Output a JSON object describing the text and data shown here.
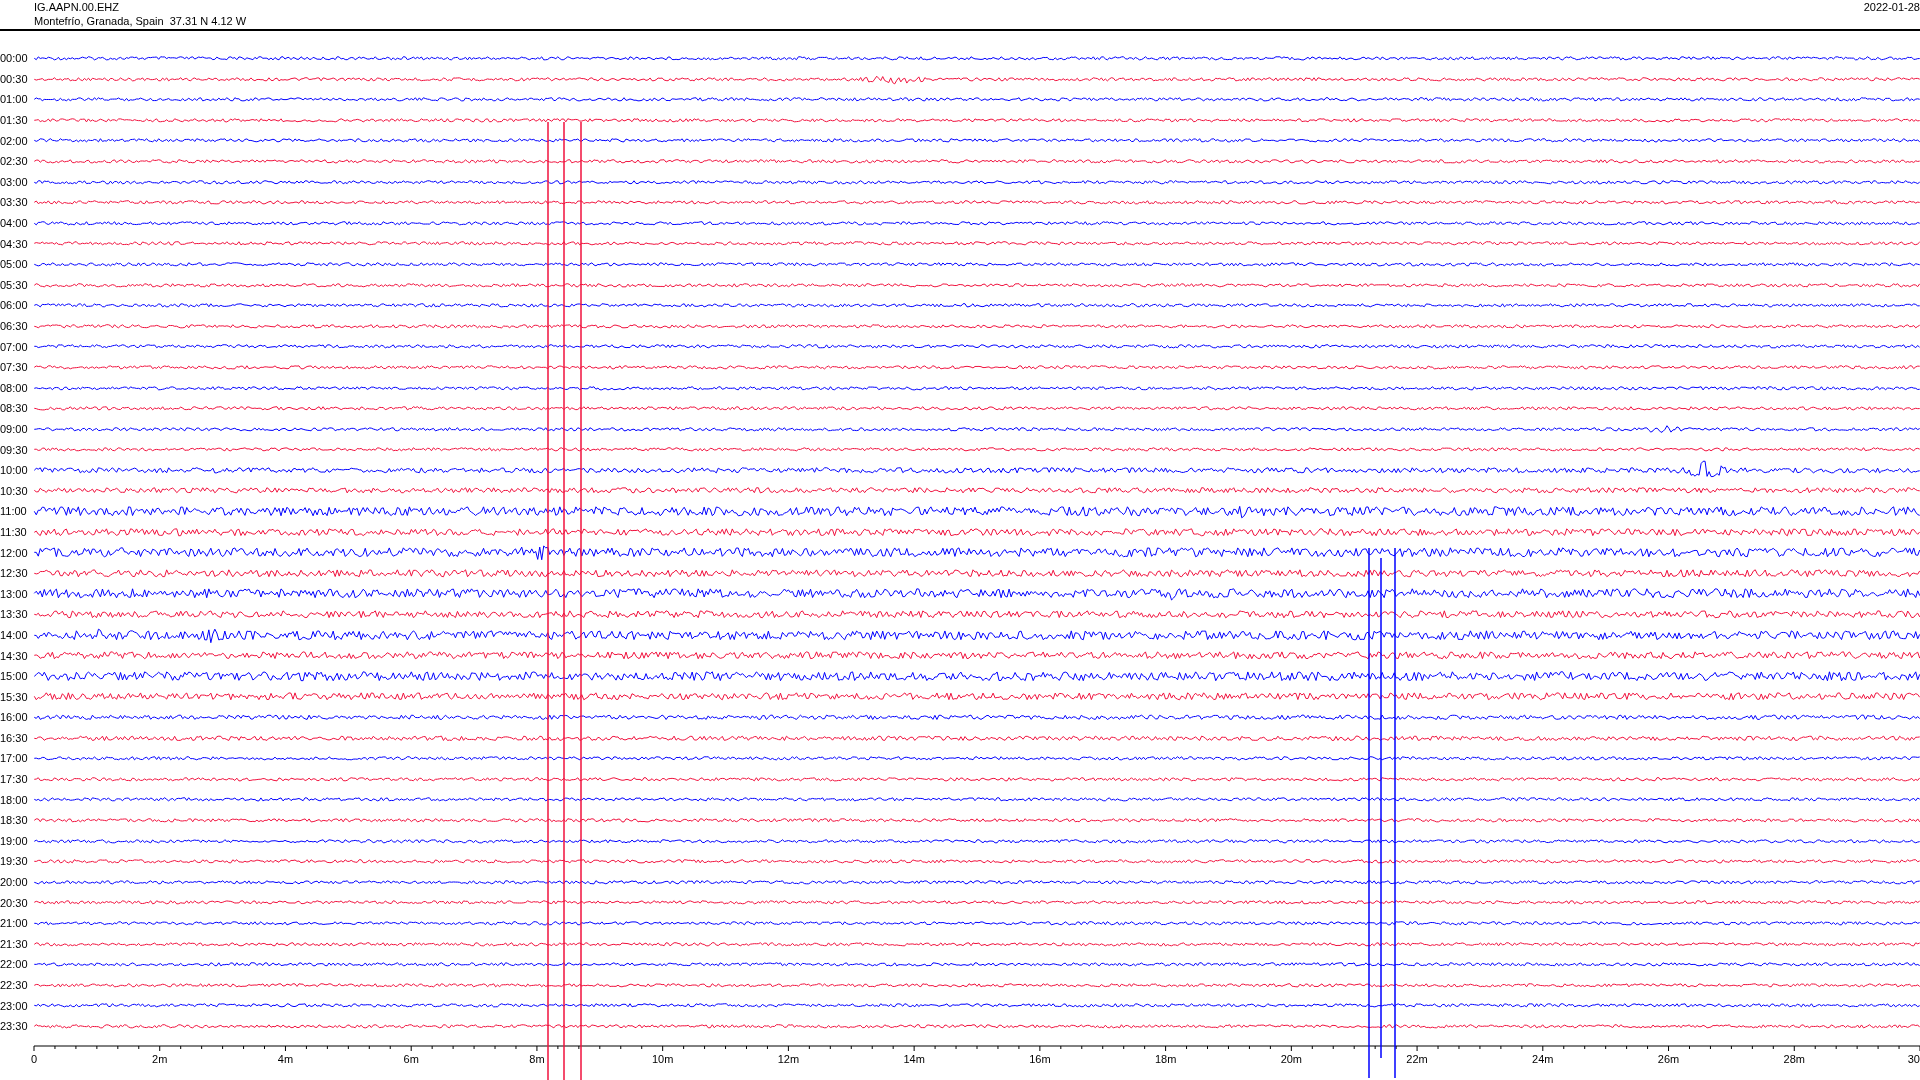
{
  "header": {
    "station": "IG.AAPN.00.EHZ",
    "location": "Montefrío, Granada, Spain  37.31 N 4.12 W",
    "date": "2022-01-28"
  },
  "rows": [
    {
      "time": "00:00",
      "color": "#0000ff"
    },
    {
      "time": "00:30",
      "color": "#f0103c"
    },
    {
      "time": "01:00",
      "color": "#0000ff"
    },
    {
      "time": "01:30",
      "color": "#f0103c"
    },
    {
      "time": "02:00",
      "color": "#0000ff"
    },
    {
      "time": "02:30",
      "color": "#f0103c"
    },
    {
      "time": "03:00",
      "color": "#0000ff"
    },
    {
      "time": "03:30",
      "color": "#f0103c"
    },
    {
      "time": "04:00",
      "color": "#0000ff"
    },
    {
      "time": "04:30",
      "color": "#f0103c"
    },
    {
      "time": "05:00",
      "color": "#0000ff"
    },
    {
      "time": "05:30",
      "color": "#f0103c"
    },
    {
      "time": "06:00",
      "color": "#0000ff"
    },
    {
      "time": "06:30",
      "color": "#f0103c"
    },
    {
      "time": "07:00",
      "color": "#0000ff"
    },
    {
      "time": "07:30",
      "color": "#f0103c"
    },
    {
      "time": "08:00",
      "color": "#0000ff"
    },
    {
      "time": "08:30",
      "color": "#f0103c"
    },
    {
      "time": "09:00",
      "color": "#0000ff"
    },
    {
      "time": "09:30",
      "color": "#f0103c"
    },
    {
      "time": "10:00",
      "color": "#0000ff"
    },
    {
      "time": "10:30",
      "color": "#f0103c"
    },
    {
      "time": "11:00",
      "color": "#0000ff"
    },
    {
      "time": "11:30",
      "color": "#f0103c"
    },
    {
      "time": "12:00",
      "color": "#0000ff"
    },
    {
      "time": "12:30",
      "color": "#f0103c"
    },
    {
      "time": "13:00",
      "color": "#0000ff"
    },
    {
      "time": "13:30",
      "color": "#f0103c"
    },
    {
      "time": "14:00",
      "color": "#0000ff"
    },
    {
      "time": "14:30",
      "color": "#f0103c"
    },
    {
      "time": "15:00",
      "color": "#0000ff"
    },
    {
      "time": "15:30",
      "color": "#f0103c"
    },
    {
      "time": "16:00",
      "color": "#0000ff"
    },
    {
      "time": "16:30",
      "color": "#f0103c"
    },
    {
      "time": "17:00",
      "color": "#0000ff"
    },
    {
      "time": "17:30",
      "color": "#f0103c"
    },
    {
      "time": "18:00",
      "color": "#0000ff"
    },
    {
      "time": "18:30",
      "color": "#f0103c"
    },
    {
      "time": "19:00",
      "color": "#0000ff"
    },
    {
      "time": "19:30",
      "color": "#f0103c"
    },
    {
      "time": "20:00",
      "color": "#0000ff"
    },
    {
      "time": "20:30",
      "color": "#f0103c"
    },
    {
      "time": "21:00",
      "color": "#0000ff"
    },
    {
      "time": "21:30",
      "color": "#f0103c"
    },
    {
      "time": "22:00",
      "color": "#0000ff"
    },
    {
      "time": "22:30",
      "color": "#f0103c"
    },
    {
      "time": "23:00",
      "color": "#0000ff"
    },
    {
      "time": "23:30",
      "color": "#f0103c"
    }
  ],
  "axis": {
    "ticks": [
      "0",
      "2m",
      "4m",
      "6m",
      "8m",
      "10m",
      "12m",
      "14m",
      "16m",
      "18m",
      "20m",
      "22m",
      "24m",
      "26m",
      "28m",
      "30"
    ]
  }
}
